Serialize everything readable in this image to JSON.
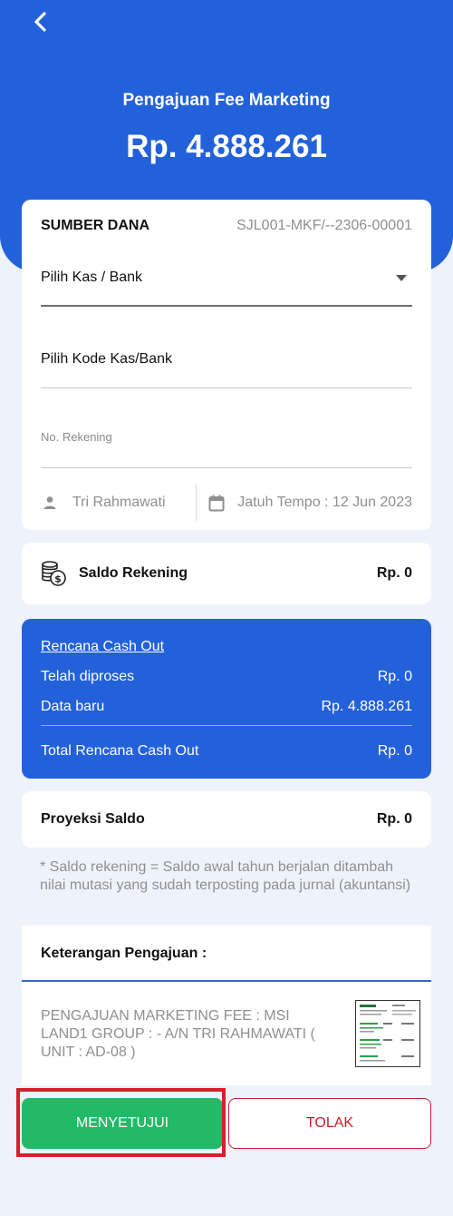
{
  "header": {
    "back_icon": "chevron-left-icon",
    "title": "Pengajuan Fee Marketing",
    "amount": "Rp. 4.888.261"
  },
  "source": {
    "label": "SUMBER DANA",
    "code": "SJL001-MKF/--2306-00001",
    "kas_bank_select": "Pilih Kas / Bank",
    "kode_kas_bank": "Pilih Kode Kas/Bank",
    "rekening_placeholder": "No. Rekening",
    "user_icon": "person-icon",
    "user_name": "Tri Rahmawati",
    "calendar_icon": "calendar-icon",
    "due_date_text": "Jatuh Tempo :  12 Jun 2023"
  },
  "saldo": {
    "icon": "coins-icon",
    "label": "Saldo Rekening",
    "value": "Rp. 0"
  },
  "cash_out": {
    "title": "Rencana Cash Out",
    "rows": [
      {
        "label": "Telah diproses",
        "value": "Rp. 0"
      },
      {
        "label": "Data baru",
        "value": "Rp. 4.888.261"
      }
    ],
    "total_label": "Total Rencana Cash Out",
    "total_value": "Rp. 0"
  },
  "projection": {
    "label": "Proyeksi Saldo",
    "value": "Rp. 0"
  },
  "note": "* Saldo rekening = Saldo awal tahun berjalan ditambah nilai mutasi yang sudah terposting pada jurnal (akuntansi)",
  "description": {
    "label": "Keterangan Pengajuan :",
    "text": "PENGAJUAN MARKETING FEE : MSI LAND1 GROUP : - A/N TRI RAHMAWATI ( UNIT : AD-08 )"
  },
  "actions": {
    "approve_label": "MENYETUJUI",
    "reject_label": "TOLAK"
  },
  "colors": {
    "primary": "#2361db",
    "approve": "#22b967",
    "reject": "#c8202b",
    "highlight": "#d61f2b"
  }
}
